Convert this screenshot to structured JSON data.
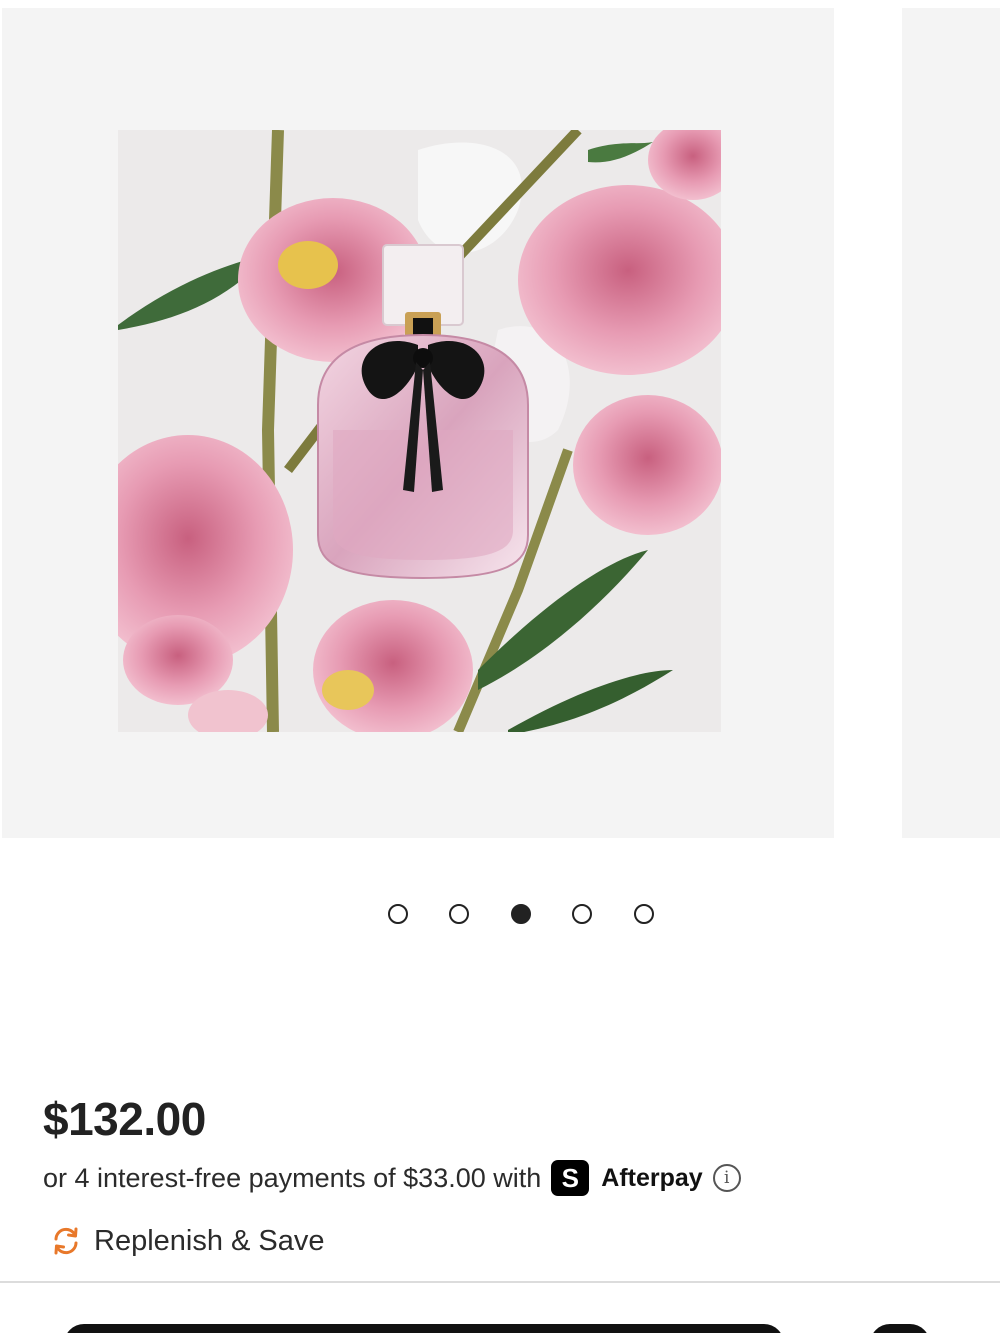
{
  "carousel": {
    "dot_count": 5,
    "active_index": 2
  },
  "product": {
    "price": "$132.00",
    "installments_text": "or 4 interest-free payments of $33.00 with",
    "afterpay_logo_symbol": "S",
    "afterpay_name": "Afterpay",
    "info_symbol": "i",
    "replenish_label": "Replenish & Save"
  },
  "colors": {
    "accent_orange": "#e8782a",
    "text": "#222222",
    "slide_bg": "#f4f4f4"
  }
}
